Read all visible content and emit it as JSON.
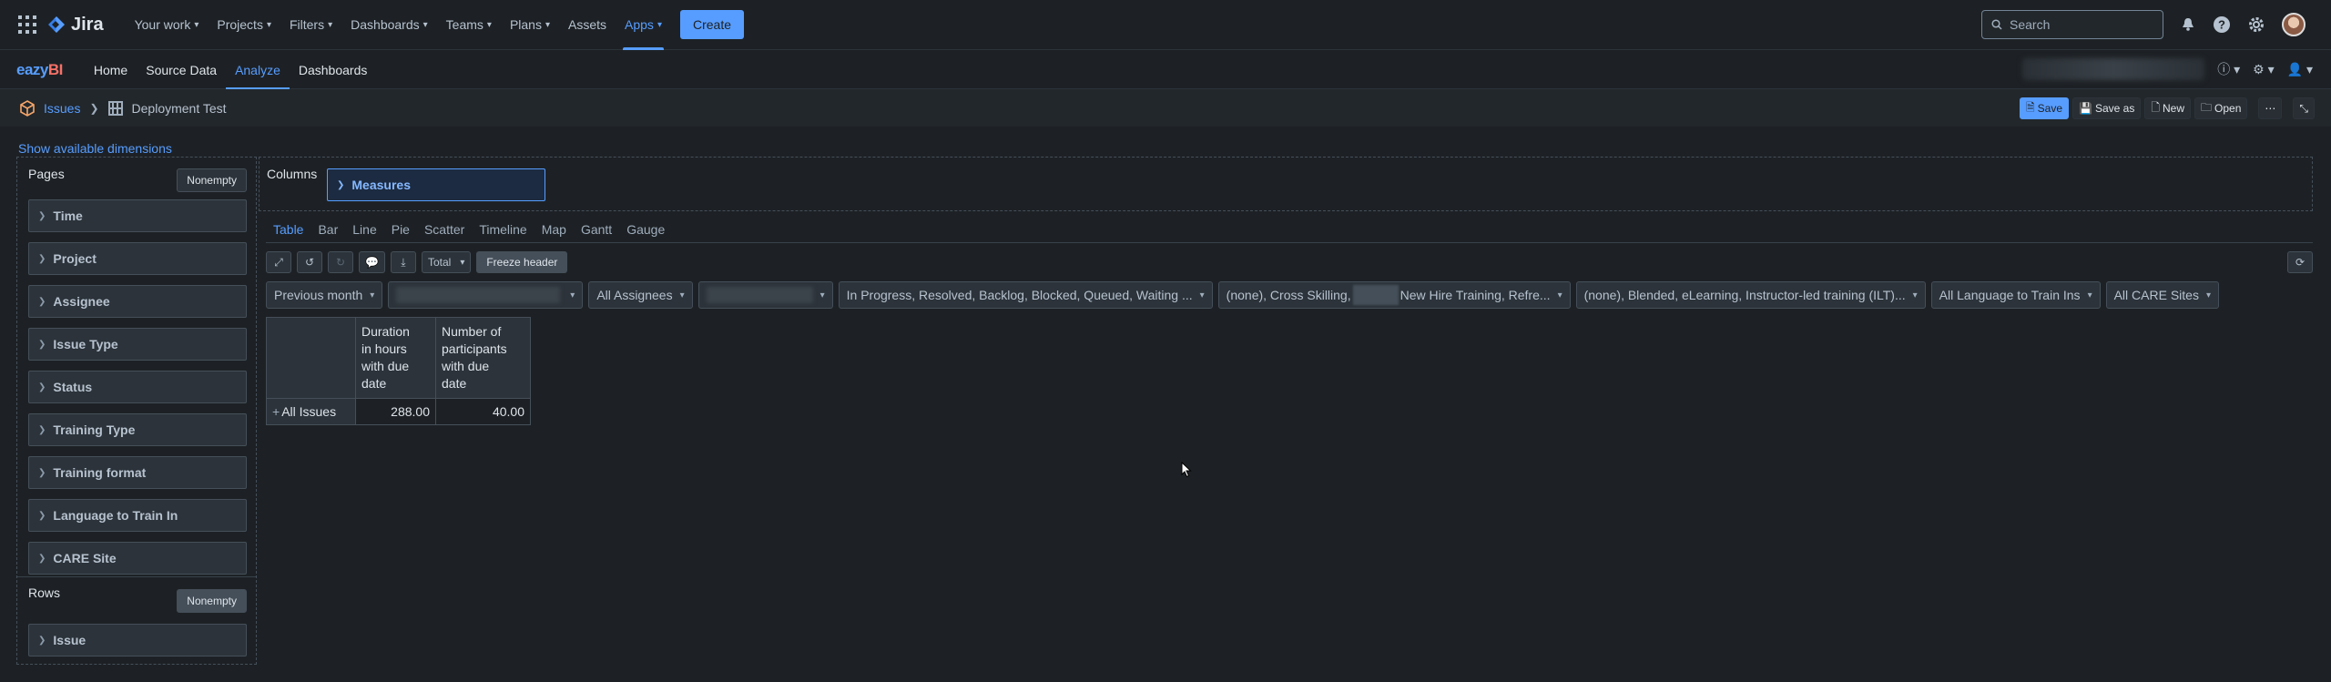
{
  "jira": {
    "brand": "Jira",
    "nav": [
      {
        "label": "Your work",
        "dropdown": true
      },
      {
        "label": "Projects",
        "dropdown": true
      },
      {
        "label": "Filters",
        "dropdown": true
      },
      {
        "label": "Dashboards",
        "dropdown": true
      },
      {
        "label": "Teams",
        "dropdown": true
      },
      {
        "label": "Plans",
        "dropdown": true
      },
      {
        "label": "Assets",
        "dropdown": false
      },
      {
        "label": "Apps",
        "dropdown": true,
        "active": true
      }
    ],
    "create_label": "Create",
    "search_placeholder": "Search"
  },
  "eazybi": {
    "logo_a": "eazy",
    "logo_b": "BI",
    "tabs": [
      "Home",
      "Source Data",
      "Analyze",
      "Dashboards"
    ],
    "active_tab": "Analyze"
  },
  "breadcrumb": {
    "cube": "Issues",
    "report": "Deployment Test"
  },
  "report_actions": {
    "save": "Save",
    "save_as": "Save as",
    "new": "New",
    "open": "Open"
  },
  "show_dimensions": "Show available dimensions",
  "pages": {
    "title": "Pages",
    "nonempty": "Nonempty",
    "dimensions": [
      "Time",
      "Project",
      "Assignee",
      "Issue Type",
      "Status",
      "Training Type",
      "Training format",
      "Language to Train In",
      "CARE Site"
    ]
  },
  "rows": {
    "title": "Rows",
    "nonempty": "Nonempty",
    "dimensions": [
      "Issue"
    ]
  },
  "columns": {
    "title": "Columns",
    "measures": "Measures"
  },
  "chart_tabs": [
    "Table",
    "Bar",
    "Line",
    "Pie",
    "Scatter",
    "Timeline",
    "Map",
    "Gantt",
    "Gauge"
  ],
  "active_chart_tab": "Table",
  "toolbar": {
    "total_label": "Total",
    "freeze_label": "Freeze header"
  },
  "filters": {
    "time": "Previous month",
    "assignee": "All Assignees",
    "status": "In Progress, Resolved, Backlog, Blocked, Queued, Waiting ...",
    "training_type_a": "(none), Cross Skilling,",
    "training_type_b": "New Hire Training, Refre...",
    "training_format": "(none), Blended, eLearning, Instructor-led training (ILT)...",
    "language": "All Language to Train Ins",
    "care_site": "All CARE Sites"
  },
  "table": {
    "headers": [
      "Duration in hours with due date",
      "Number of participants with due date"
    ],
    "header_lines": [
      [
        "Duration",
        "in hours",
        "with due",
        "date"
      ],
      [
        "Number of",
        "participants",
        "with due",
        "date"
      ]
    ],
    "rows": [
      {
        "label": "All Issues",
        "values": [
          "288.00",
          "40.00"
        ]
      }
    ]
  }
}
